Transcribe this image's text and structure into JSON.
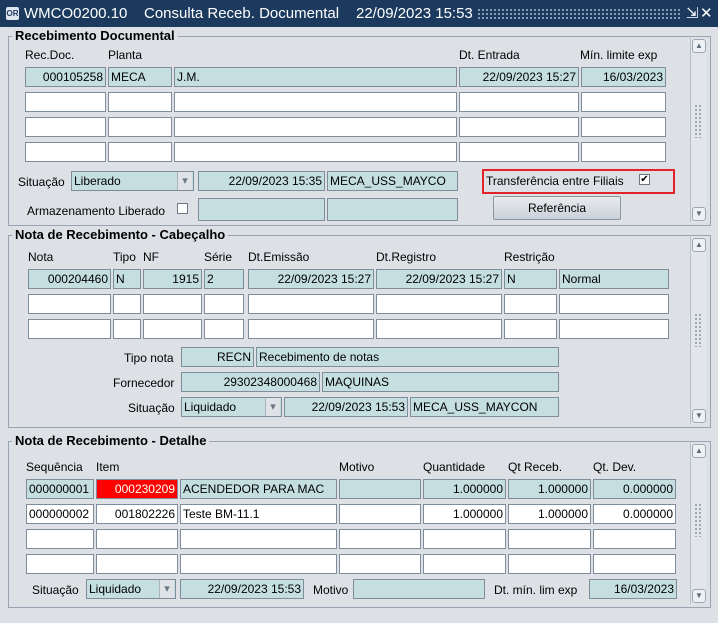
{
  "titlebar": {
    "window_code": "WMCO0200.10",
    "window_title": "Consulta Receb. Documental",
    "datetime": "22/09/2023 15:53",
    "icon_text": "OR",
    "resize_glyph": "⇲",
    "close_glyph": "✕"
  },
  "rec_doc": {
    "title": "Recebimento Documental",
    "headers": {
      "rec_doc": "Rec.Doc.",
      "planta": "Planta",
      "dt_entrada": "Dt. Entrada",
      "min_limite": "Mín. limite exp"
    },
    "row1": {
      "rec_doc": "000105258",
      "planta": "MECA",
      "desc": "J.M.",
      "dt_entrada": "22/09/2023 15:27",
      "min_limite": "16/03/2023"
    },
    "situacao_label": "Situação",
    "situacao_value": "Liberado",
    "situacao_datetime": "22/09/2023 15:35",
    "situacao_user": "MECA_USS_MAYCO",
    "transferencia_label": "Transferência entre Filiais",
    "transferencia_checked": "✔",
    "armazenamento_label": "Armazenamento Liberado",
    "referencia_button": "Referência"
  },
  "cabecalho": {
    "title": "Nota de Recebimento - Cabeçalho",
    "headers": {
      "nota": "Nota",
      "tipo": "Tipo",
      "nf": "NF",
      "serie": "Série",
      "dt_emissao": "Dt.Emissão",
      "dt_registro": "Dt.Registro",
      "restricao": "Restrição"
    },
    "row1": {
      "nota": "000204460",
      "tipo": "N",
      "nf": "1915",
      "serie": "2",
      "dt_emissao": "22/09/2023 15:27",
      "dt_registro": "22/09/2023 15:27",
      "restricao": "N",
      "restricao_desc": "Normal"
    },
    "tipo_nota_label": "Tipo nota",
    "tipo_nota_code": "RECN",
    "tipo_nota_desc": "Recebimento de notas",
    "fornecedor_label": "Fornecedor",
    "fornecedor_cnpj": "29302348000468",
    "fornecedor_name": "MAQUINAS",
    "situacao_label": "Situação",
    "situacao_value": "Liquidado",
    "situacao_datetime": "22/09/2023 15:53",
    "situacao_user": "MECA_USS_MAYCON"
  },
  "detalhe": {
    "title": "Nota de Recebimento - Detalhe",
    "headers": {
      "sequencia": "Sequência",
      "item": "Item",
      "motivo": "Motivo",
      "quantidade": "Quantidade",
      "qt_receb": "Qt  Receb.",
      "qt_dev": "Qt. Dev."
    },
    "rows": [
      {
        "sequencia": "000000001",
        "item": "000230209",
        "descricao": "ACENDEDOR PARA MAC",
        "motivo": "",
        "quantidade": "1.000000",
        "qt_receb": "1.000000",
        "qt_dev": "0.000000"
      },
      {
        "sequencia": "000000002",
        "item": "001802226",
        "descricao": "Teste BM-11.1",
        "motivo": "",
        "quantidade": "1.000000",
        "qt_receb": "1.000000",
        "qt_dev": "0.000000"
      }
    ],
    "situacao_label": "Situação",
    "situacao_value": "Liquidado",
    "situacao_datetime": "22/09/2023 15:53",
    "motivo_label": "Motivo",
    "dt_min_label": "Dt. mín. lim exp",
    "dt_min_value": "16/03/2023"
  },
  "colors": {
    "titlebar": "#1b3a5e",
    "readonly_field": "#c5dfe1",
    "highlight_red": "#ff0000",
    "focus_outline": "#e0242a"
  }
}
